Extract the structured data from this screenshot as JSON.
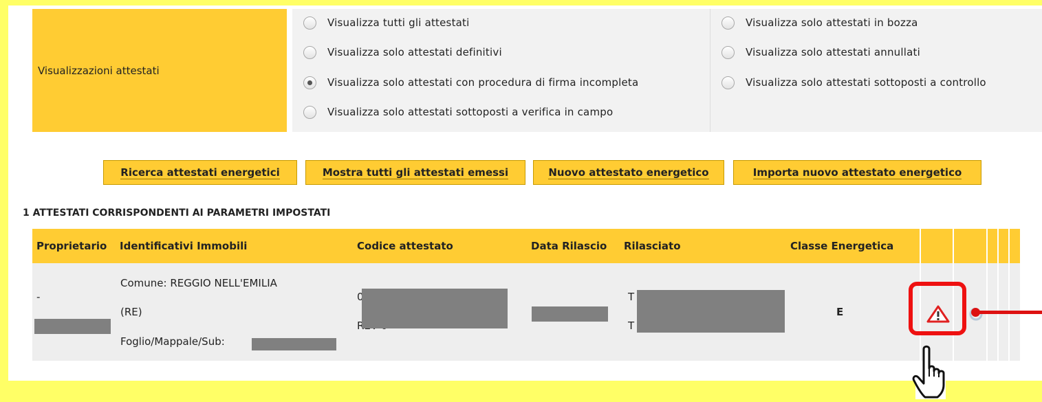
{
  "filters": {
    "label": "Visualizzazioni attestati",
    "options": [
      {
        "label": "Visualizza tutti gli attestati",
        "checked": false
      },
      {
        "label": "Visualizza solo attestati in bozza",
        "checked": false
      },
      {
        "label": "Visualizza solo attestati definitivi",
        "checked": false
      },
      {
        "label": "Visualizza solo attestati annullati",
        "checked": false
      },
      {
        "label": "Visualizza solo attestati con procedura di firma incompleta",
        "checked": true
      },
      {
        "label": "Visualizza solo attestati sottoposti a controllo",
        "checked": false
      },
      {
        "label": "Visualizza solo attestati sottoposti a verifica in campo",
        "checked": false
      }
    ]
  },
  "toolbar": {
    "search_label": "Ricerca attestati energetici",
    "show_all_label": "Mostra tutti gli attestati emessi",
    "new_label": "Nuovo attestato energetico",
    "import_label": "Importa nuovo attestato energetico"
  },
  "results": {
    "title": "1  ATTESTATI CORRISPONDENTI AI PARAMETRI IMPOSTATI",
    "columns": [
      "Proprietario",
      "Identificativi Immobili",
      "Codice attestato",
      "Data Rilascio",
      "Rilasciato",
      "Classe Energetica"
    ],
    "rows": [
      {
        "proprietario": "-",
        "comune": "Comune: REGGIO NELL'EMILIA",
        "provincia": "(RE)",
        "foglio": "Foglio/Mappale/Sub:",
        "codice_prefix": "0",
        "codice_suffix": "REV 0",
        "rilasciato_1": "T",
        "rilasciato_2": "T",
        "classe": "E"
      }
    ]
  },
  "icons": {
    "warning": "warning-triangle-icon",
    "cursor": "hand-pointer-icon"
  },
  "colors": {
    "background": "#ffff66",
    "accent": "#ffcc33",
    "highlight": "#ee1111"
  }
}
